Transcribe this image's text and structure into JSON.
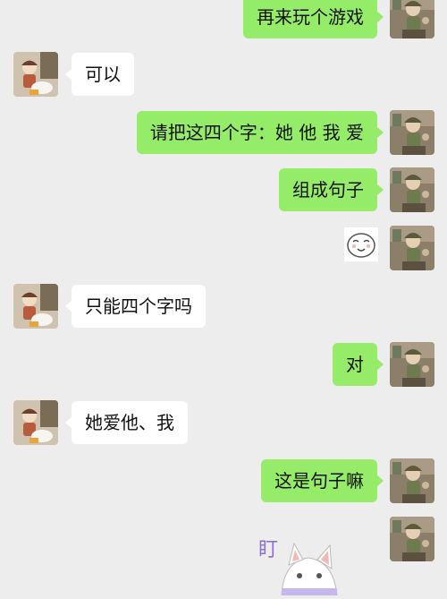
{
  "colors": {
    "chat_bg": "#ededed",
    "my_bubble": "#95ec69",
    "their_bubble": "#ffffff"
  },
  "messages": [
    {
      "sender": "me",
      "text": "再来玩个游戏"
    },
    {
      "sender": "them",
      "text": "可以"
    },
    {
      "sender": "me",
      "text": "请把这四个字：她 他 我 爱"
    },
    {
      "sender": "me",
      "text": "组成句子"
    },
    {
      "sender": "me",
      "type": "sticker",
      "sticker_name": "smiling-face-sticker"
    },
    {
      "sender": "them",
      "text": "只能四个字吗"
    },
    {
      "sender": "me",
      "text": "对"
    },
    {
      "sender": "them",
      "text": "她爱他、我"
    },
    {
      "sender": "me",
      "text": "这是句子嘛"
    },
    {
      "sender": "me",
      "type": "sticker",
      "sticker_name": "cat-stare-sticker",
      "sticker_text": "盯"
    }
  ]
}
